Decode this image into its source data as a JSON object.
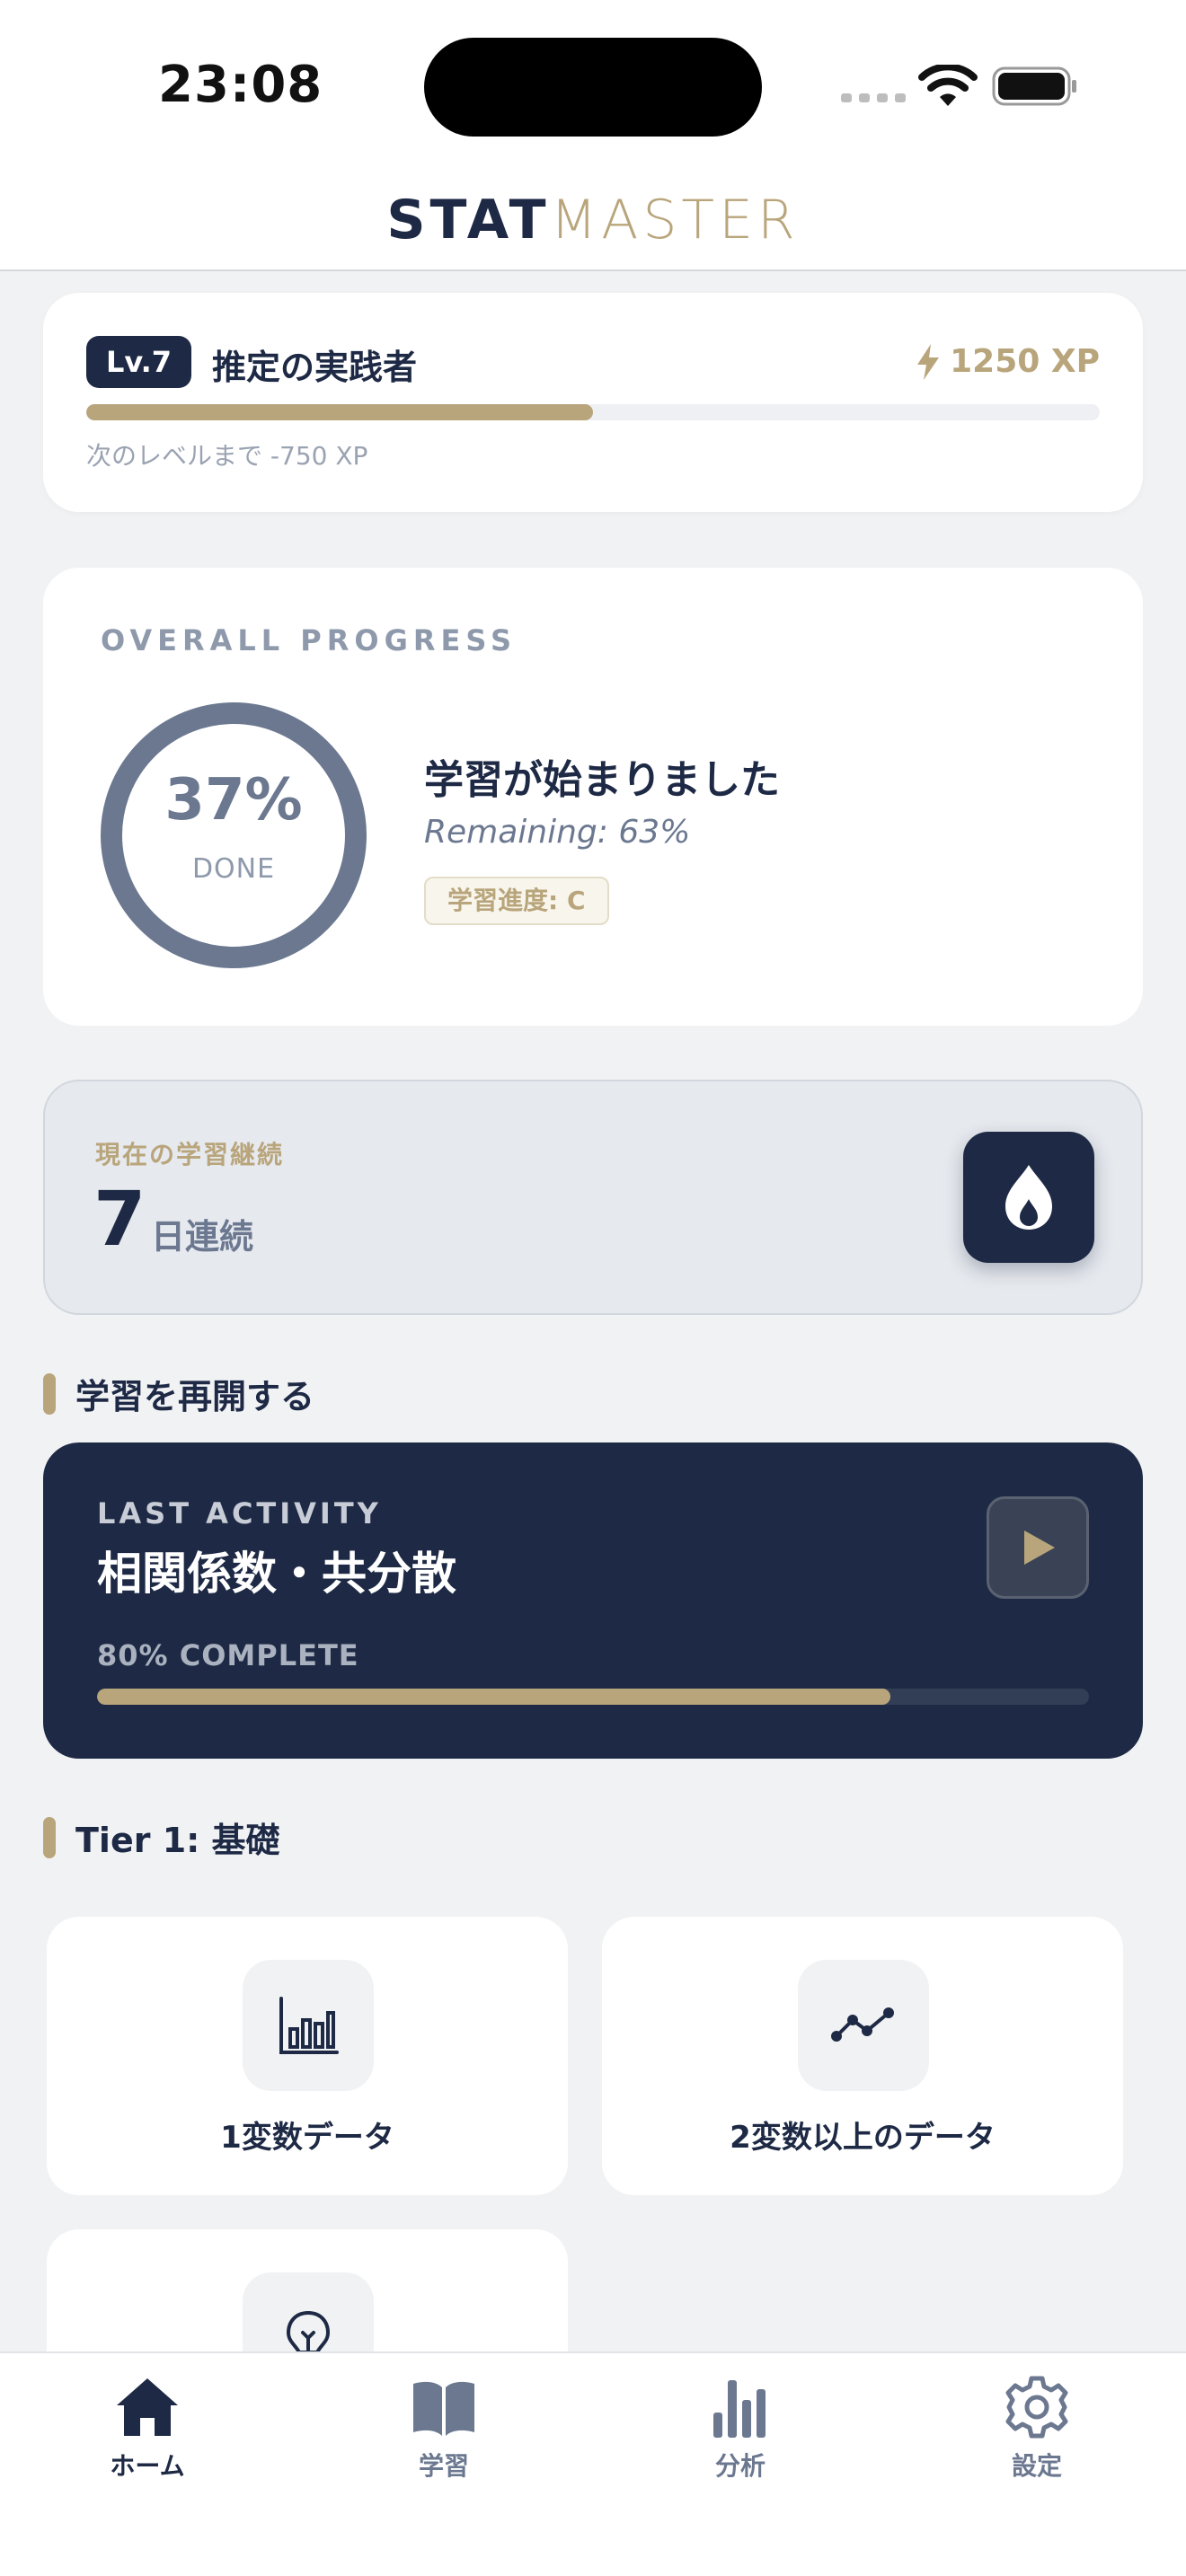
{
  "status_bar": {
    "time": "23:08"
  },
  "app": {
    "logo_bold": "STAT",
    "logo_light": "MASTER"
  },
  "level": {
    "badge": "Lv.7",
    "title": "推定の実践者",
    "xp": "1250 XP",
    "progress": 0.5,
    "next_level": "次のレベルまで -750 XP"
  },
  "overall": {
    "label": "OVERALL PROGRESS",
    "percent_text": "37%",
    "percent": 37,
    "done": "DONE",
    "title": "学習が始まりました",
    "remaining": "Remaining: 63%",
    "grade": "学習進度: C"
  },
  "streak": {
    "label": "現在の学習継続",
    "days": "7",
    "unit": "日連続"
  },
  "resume": {
    "heading": "学習を再開する",
    "label": "LAST ACTIVITY",
    "title": "相関係数・共分散",
    "complete": "80% COMPLETE",
    "progress": 80
  },
  "tier1": {
    "heading": "Tier 1: 基礎",
    "tiles": [
      {
        "label": "1変数データ",
        "icon": "bar-chart-icon"
      },
      {
        "label": "2変数以上のデータ",
        "icon": "line-chart-icon"
      },
      {
        "label": "",
        "icon": "lightbulb-icon"
      }
    ]
  },
  "tabs": [
    {
      "label": "ホーム",
      "icon": "home-icon",
      "active": true
    },
    {
      "label": "学習",
      "icon": "book-icon",
      "active": false
    },
    {
      "label": "分析",
      "icon": "analytics-icon",
      "active": false
    },
    {
      "label": "設定",
      "icon": "gear-icon",
      "active": false
    }
  ],
  "colors": {
    "navy": "#1e2a45",
    "gold": "#b9a57b",
    "slate": "#6b7890"
  }
}
